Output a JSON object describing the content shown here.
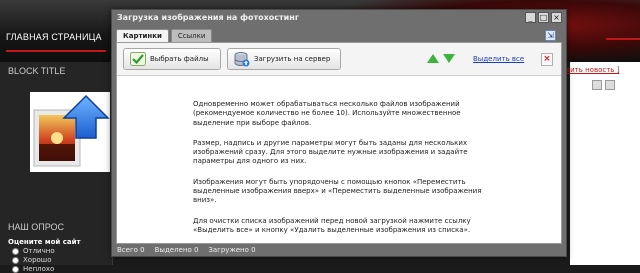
{
  "site": {
    "nav_home": "ГЛАВНАЯ СТРАНИЦА",
    "block_title": "BLOCK TITLE",
    "poll_title": "НАШ ОПРОС",
    "poll_question": "Оцените мой сайт",
    "poll_options": [
      "Отлично",
      "Хорошо",
      "Неплохо"
    ],
    "add_news_link": "вить новость ]"
  },
  "dialog": {
    "title": "Загрузка изображения на фотохостинг",
    "window_buttons": [
      "_",
      "□",
      "×"
    ],
    "tabs": [
      {
        "label": "Картинки",
        "active": true
      },
      {
        "label": "Ссылки",
        "active": false
      }
    ],
    "expand_icon": "⇲",
    "toolbar": {
      "select_files_label": "Выбрать файлы",
      "upload_label": "Загрузить на сервер",
      "select_all_label": "Выделить все",
      "delete_icon": "×"
    },
    "help_paragraphs": [
      "Одновременно может обрабатываться несколько файлов изображений (рекомендуемое количество не более 10). Используйте множественное выделение при выборе файлов.",
      "Размер, надпись и другие параметры могут быть заданы для нескольких изображений сразу. Для этого выделите нужные изображения и задайте параметры для одного из них.",
      "Изображения могут быть упорядочены с помощью кнопок «Переместить выделенные изображения вверх» и «Переместить выделенные изображения вниз».",
      "Для очистки списка изображений перед новой загрузкой нажмите ссылку «Выделить все» и кнопку «Удалить выделенные изображения из списка»."
    ],
    "status": {
      "total": "Всего 0",
      "selected": "Выделено 0",
      "uploaded": "Загружено 0"
    }
  },
  "colors": {
    "accent_red": "#c01818",
    "link_blue": "#1a3fb0",
    "arrow_green": "#3cb43c"
  }
}
